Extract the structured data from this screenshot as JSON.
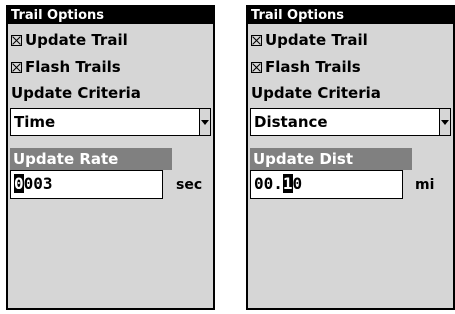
{
  "left_panel": {
    "title": "Trail Options",
    "update_trail_label": "Update Trail",
    "update_trail_checked": true,
    "flash_trails_label": "Flash Trails",
    "flash_trails_checked": true,
    "criteria_label": "Update Criteria",
    "criteria_value": "Time",
    "field_label": "Update Rate",
    "field_value_cursor": "0",
    "field_value_rest": "003",
    "field_unit": "sec"
  },
  "right_panel": {
    "title": "Trail Options",
    "update_trail_label": "Update Trail",
    "update_trail_checked": true,
    "flash_trails_label": "Flash Trails",
    "flash_trails_checked": true,
    "criteria_label": "Update Criteria",
    "criteria_value": "Distance",
    "field_label": "Update Dist",
    "field_value_before": "00.",
    "field_value_cursor": "1",
    "field_value_after": "0",
    "field_unit": "mi"
  },
  "icons": {
    "checkbox": "checkbox-checked-icon",
    "dropdown": "dropdown-arrow-icon"
  }
}
